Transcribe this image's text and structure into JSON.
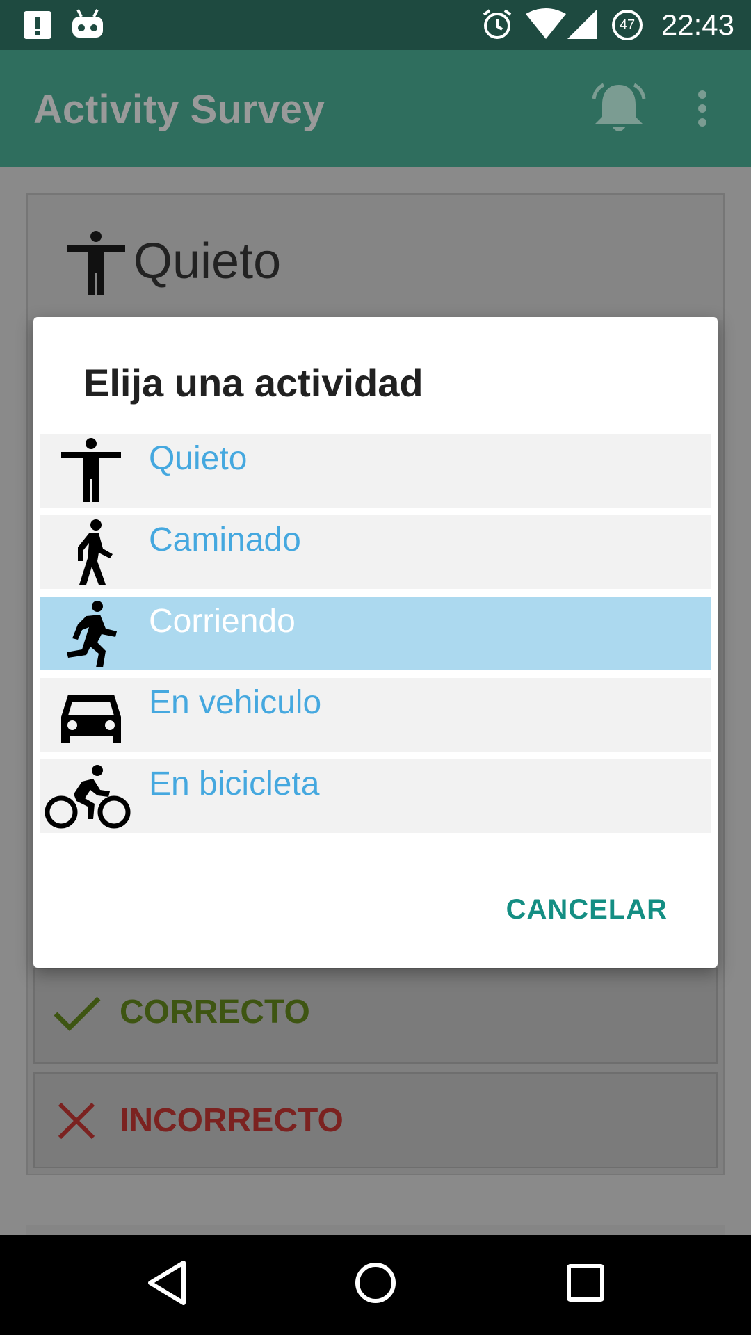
{
  "status_bar": {
    "time": "22:43",
    "battery_level": "47"
  },
  "app_bar": {
    "title": "Activity Survey"
  },
  "background": {
    "current_activity": "Quieto",
    "correct_label": "CORRECTO",
    "incorrect_label": "INCORRECTO"
  },
  "dialog": {
    "title": "Elija una actividad",
    "items": [
      {
        "label": "Quieto",
        "icon": "standing-person-icon",
        "selected": false
      },
      {
        "label": "Caminado",
        "icon": "walking-person-icon",
        "selected": false
      },
      {
        "label": "Corriendo",
        "icon": "running-person-icon",
        "selected": true
      },
      {
        "label": "En vehiculo",
        "icon": "car-icon",
        "selected": false
      },
      {
        "label": "En bicicleta",
        "icon": "bicycle-icon",
        "selected": false
      }
    ],
    "cancel_label": "CANCELAR"
  },
  "colors": {
    "accent": "#148e83",
    "item_text": "#45a8df",
    "selected_bg": "#acd9ef",
    "status_bar": "#1e4a40",
    "app_bar": "#2f6e5e"
  }
}
